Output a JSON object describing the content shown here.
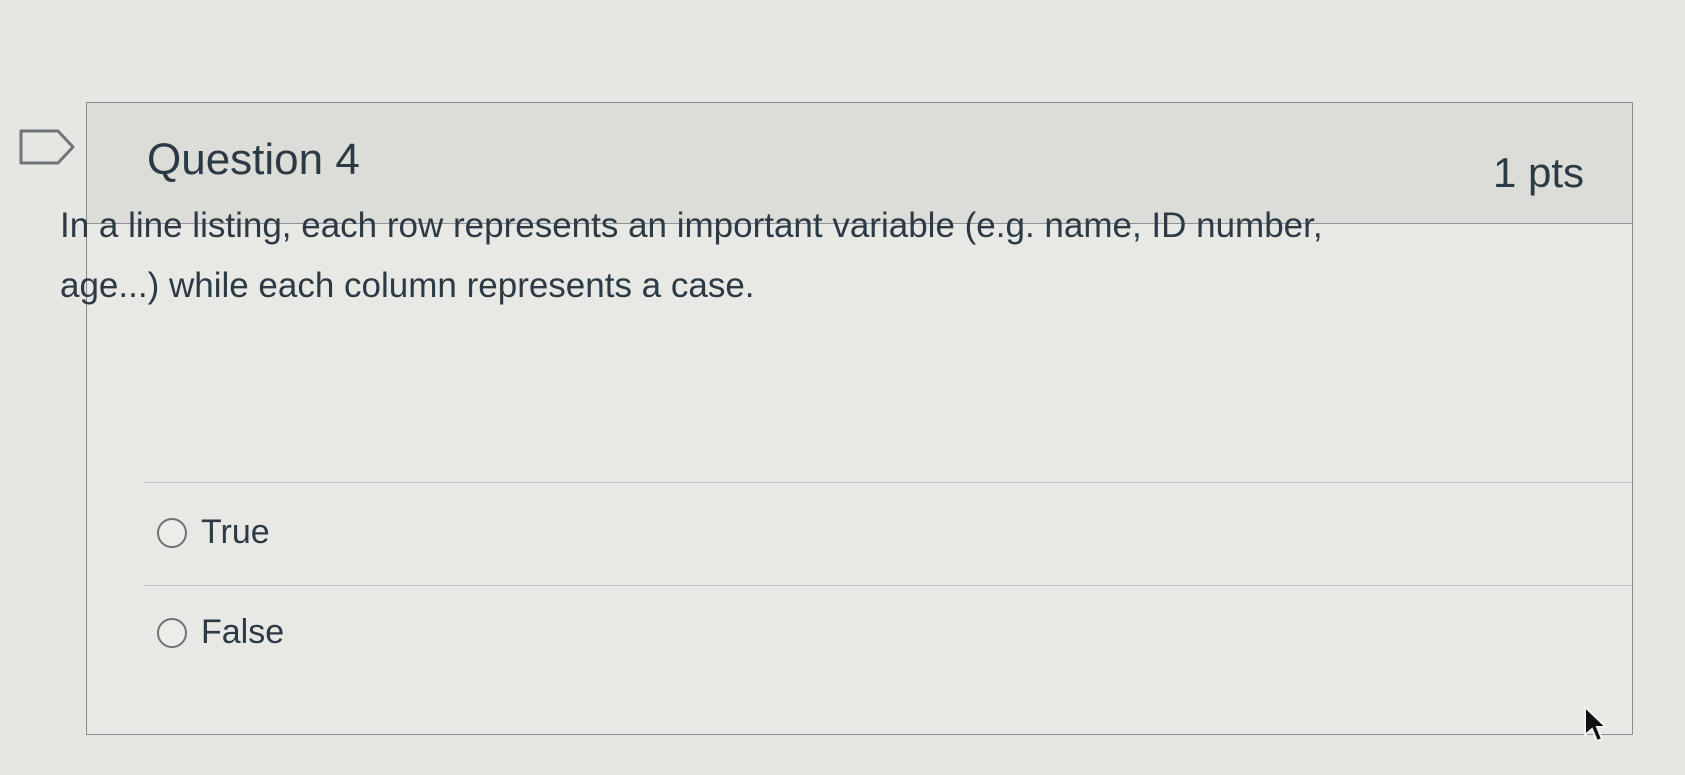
{
  "question": {
    "title": "Question 4",
    "points": "1 pts",
    "text": "In a line listing, each row represents an important variable (e.g. name, ID number, age...) while each column represents a case.",
    "flag_icon": "flag-outline-icon"
  },
  "answers": [
    {
      "label": "True",
      "selected": false
    },
    {
      "label": "False",
      "selected": false
    }
  ],
  "cursor_icon": "mouse-pointer-icon"
}
